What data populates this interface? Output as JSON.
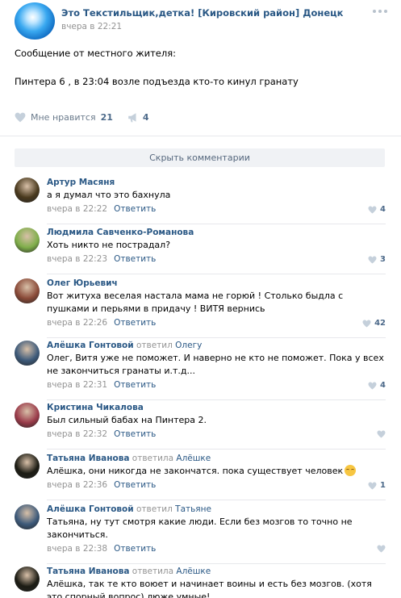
{
  "post": {
    "group_name": "Это Текстильщик,детка! [Кировский район] Донецк",
    "time": "вчера в 22:21",
    "text_line1": "Сообщение от местного жителя:",
    "text_line2": "Пинтера 6 , в 23:04 возле подъезда кто-то кинул гранату",
    "like_label": "Мне нравится",
    "like_count": "21",
    "share_count": "4"
  },
  "hide_comments_label": "Скрыть комментарии",
  "answer_label": "Ответить",
  "comments": [
    {
      "author": "Артур Масяня",
      "reply_verb": "",
      "reply_to": "",
      "text": "а я думал что это бахнула",
      "time": "вчера в 22:22",
      "likes": "4",
      "avatar_color": "#4a3a1e"
    },
    {
      "author": "Людмила Савченко-Романова",
      "reply_verb": "",
      "reply_to": "",
      "text": "Хоть никто не пострадал?",
      "time": "вчера в 22:23",
      "likes": "3",
      "avatar_color": "#7fae4a"
    },
    {
      "author": "Олег Юрьевич",
      "reply_verb": "",
      "reply_to": "",
      "text": "Вот житуха веселая настала мама не горюй ! Столько быдла с пушками и перьями в придачу ! ВИТЯ вернись",
      "time": "вчера в 22:26",
      "likes": "42",
      "avatar_color": "#8a4a38"
    },
    {
      "author": "Алёшка Гонтовой",
      "reply_verb": "ответил",
      "reply_to": "Олегу",
      "text": "Олег, Витя уже не поможет. И наверно не кто не поможет. Пока у всех не закончиться гранаты и.т.д...",
      "time": "вчера в 22:31",
      "likes": "4",
      "avatar_color": "#3d5a7a"
    },
    {
      "author": "Кристина Чикалова",
      "reply_verb": "",
      "reply_to": "",
      "text": "Был сильный бабах на Пинтера 2.",
      "time": "вчера в 22:32",
      "likes": "",
      "avatar_color": "#9a3b4a"
    },
    {
      "author": "Татьяна Иванова",
      "reply_verb": "ответила",
      "reply_to": "Алёшке",
      "text": "Алёшка, они никогда не закончатся. пока существует человек",
      "time": "вчера в 22:36",
      "likes": "1",
      "avatar_color": "#1c1c14",
      "emoji": true
    },
    {
      "author": "Алёшка Гонтовой",
      "reply_verb": "ответил",
      "reply_to": "Татьяне",
      "text": "Татьяна, ну тут смотря какие люди. Если без мозгов то точно не закончиться.",
      "time": "вчера в 22:38",
      "likes": "",
      "avatar_color": "#3d5a7a"
    },
    {
      "author": "Татьяна Иванова",
      "reply_verb": "ответила",
      "reply_to": "Алёшке",
      "text": "Алёшка, так те кто воюет и начинает воины и есть без мозгов. (хотя это спорный вопрос) люже умные!",
      "time": "",
      "likes": "",
      "avatar_color": "#1c1c14"
    }
  ]
}
